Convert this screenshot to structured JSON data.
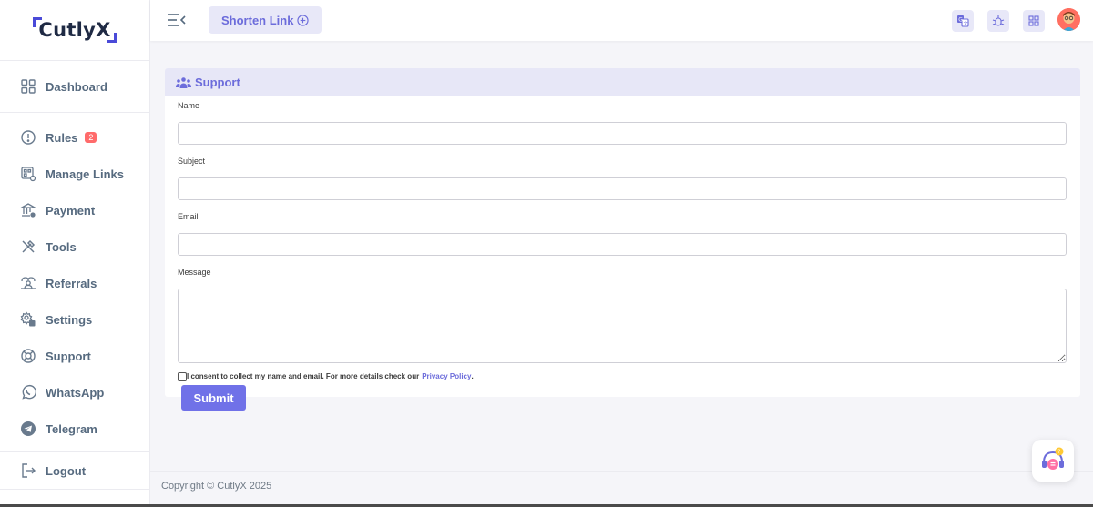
{
  "app": {
    "logo_text": "CutlyX"
  },
  "sidebar": {
    "items": [
      {
        "label": "Dashboard",
        "icon": "grid-icon"
      },
      {
        "label": "Rules",
        "icon": "alert-circle-icon",
        "badge": "2"
      },
      {
        "label": "Manage Links",
        "icon": "link-grid-icon"
      },
      {
        "label": "Payment",
        "icon": "bank-icon"
      },
      {
        "label": "Tools",
        "icon": "tools-icon"
      },
      {
        "label": "Referrals",
        "icon": "referrals-icon"
      },
      {
        "label": "Settings",
        "icon": "settings-icon"
      },
      {
        "label": "Support",
        "icon": "lifebuoy-icon"
      },
      {
        "label": "WhatsApp",
        "icon": "whatsapp-icon"
      },
      {
        "label": "Telegram",
        "icon": "telegram-icon"
      }
    ],
    "logout": {
      "label": "Logout",
      "icon": "logout-icon"
    }
  },
  "topbar": {
    "shorten_label": "Shorten Link",
    "icons": [
      "translate-icon",
      "bug-icon",
      "apps-icon",
      "avatar"
    ]
  },
  "card": {
    "title": "Support",
    "fields": {
      "name": {
        "label": "Name",
        "value": ""
      },
      "subject": {
        "label": "Subject",
        "value": ""
      },
      "email": {
        "label": "Email",
        "value": ""
      },
      "message": {
        "label": "Message",
        "value": ""
      }
    },
    "consent_text": "I consent to collect my name and email. For more details check our",
    "consent_link": "Privacy Policy",
    "consent_end": ".",
    "submit_label": "Submit"
  },
  "footer": {
    "copyright": "Copyright © CutlyX 2025"
  },
  "colors": {
    "accent": "#7071e8",
    "accent_soft": "#e7e7f7",
    "badge": "#ff6b6b"
  }
}
